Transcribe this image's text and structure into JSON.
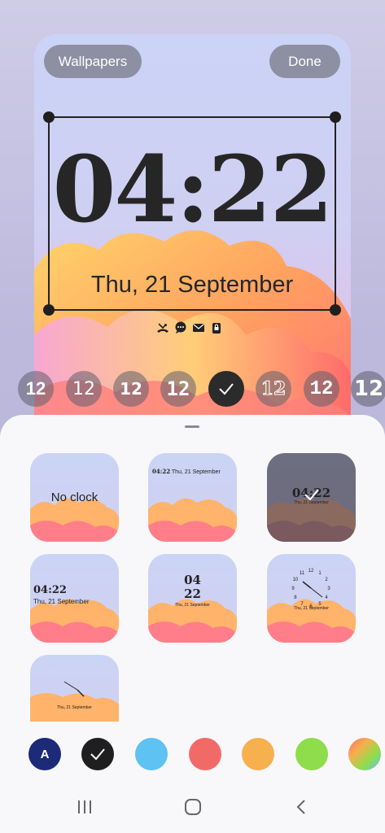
{
  "top_buttons": {
    "wallpapers_label": "Wallpapers",
    "done_label": "Done"
  },
  "lock_clock": {
    "time": "04:22",
    "date": "Thu, 21 September"
  },
  "notification_icons": [
    "missed-call-icon",
    "message-icon",
    "mail-icon",
    "lock-badge-icon"
  ],
  "clock_fonts": {
    "chips": [
      "12",
      "12",
      "12",
      "12",
      "selected",
      "12",
      "12",
      "12"
    ],
    "selected_index": 4
  },
  "clock_styles": [
    {
      "id": "no-clock",
      "label": "No clock"
    },
    {
      "id": "horizontal-small",
      "time": "04:22",
      "date": "Thu, 21 September"
    },
    {
      "id": "dark-centered",
      "time": "04:22",
      "date": "Thu, 21 September",
      "selected": true
    },
    {
      "id": "left-aligned",
      "time": "04:22",
      "date": "Thu, 21 September"
    },
    {
      "id": "stacked",
      "hours": "04",
      "minutes": "22",
      "date": "Thu, 21 September"
    },
    {
      "id": "analog-numbers",
      "numbers": [
        "12",
        "1",
        "2",
        "3",
        "4",
        "5",
        "6",
        "7",
        "8",
        "9",
        "10",
        "11"
      ],
      "date": "Thu, 21 September"
    },
    {
      "id": "analog-minimal",
      "date": "Thu, 21 September"
    }
  ],
  "color_swatches": [
    {
      "name": "auto",
      "label": "A",
      "color": "#1d2a78"
    },
    {
      "name": "black",
      "color": "#1f1f1f",
      "selected": true
    },
    {
      "name": "blue",
      "color": "#5ec2f2"
    },
    {
      "name": "red",
      "color": "#f26a67"
    },
    {
      "name": "orange",
      "color": "#f6b04e"
    },
    {
      "name": "green",
      "color": "#8fdd4a"
    },
    {
      "name": "gradient",
      "color": "multicolor"
    }
  ],
  "nav_bar": [
    "recents-icon",
    "home-icon",
    "back-icon"
  ]
}
